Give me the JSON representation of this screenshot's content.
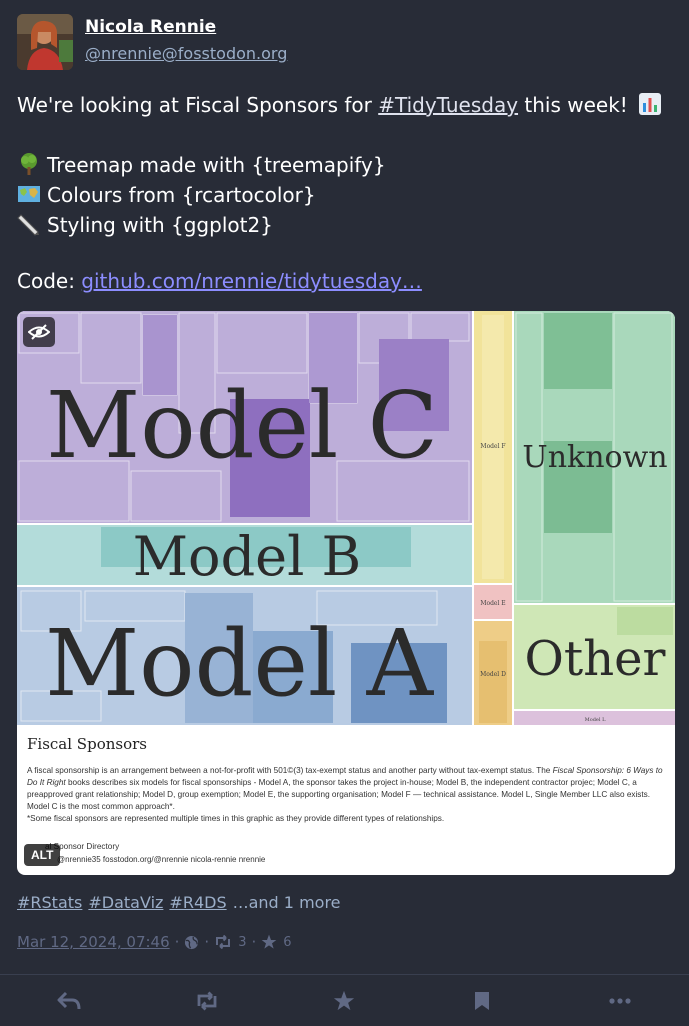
{
  "author": {
    "display_name": "Nicola Rennie",
    "handle": "@nrennie@fosstodon.org"
  },
  "content": {
    "line1_prefix": "We're looking at Fiscal Sponsors for ",
    "line1_hashtag": "#TidyTuesday",
    "line1_suffix": " this week!",
    "bullet1": "Treemap made with {treemapify}",
    "bullet2": "Colours from {rcartocolor}",
    "bullet3": "Styling with {ggplot2}",
    "code_label": "Code: ",
    "code_link": "github.com/nrennie/tidytuesday…"
  },
  "media": {
    "alt_badge": "ALT",
    "treemap_labels": {
      "model_c": "Model C",
      "model_b": "Model B",
      "model_a": "Model A",
      "unknown": "Unknown",
      "other": "Other",
      "model_f": "Model F",
      "model_e": "Model E",
      "model_d": "Model D",
      "model_l": "Model L"
    },
    "caption_title": "Fiscal Sponsors",
    "caption_body_1": "A fiscal sponsorship is an arrangement between a not-for-profit with 501©(3) tax-exempt status and another party without tax-exempt status. The ",
    "caption_body_book": "Fiscal Sponsorship: 6 Ways to Do It Right",
    "caption_body_2": " books describes six models for fiscal sponsorships - Model A, the sponsor takes the project in-house; Model B, the independent contractor projec; Model C, a preapproved grant relationship; Model D, group exemption; Model E, the supporting organisation; Model F — technical assistance. Model L, Single Member LLC also exists. Model C is the most common approach*.",
    "caption_note": "*Some fiscal sponsors are represented multiple times in this graphic as they provide different types of relationships.",
    "caption_source": "al Sponsor Directory",
    "caption_social": "@nrennie35   fosstodon.org/@nrennie   nicola-rennie   nrennie",
    "colors": {
      "model_c": "#b9a8d6",
      "model_b": "#a9d6d4",
      "model_a": "#b3c6df",
      "unknown": "#a6d6b8",
      "other": "#cde6b4",
      "model_f": "#f3e6a0",
      "model_e": "#f0c4c4",
      "model_d": "#f0d08a",
      "model_l": "#dcc0dc"
    }
  },
  "hashtags": [
    "#RStats",
    "#DataViz",
    "#R4DS"
  ],
  "hashtags_more": "…and 1 more",
  "meta": {
    "timestamp": "Mar 12, 2024, 07:46",
    "boosts": "3",
    "favourites": "6"
  },
  "theme": {
    "background": "#282c37",
    "accent": "#8c8dff",
    "muted": "#606984"
  }
}
